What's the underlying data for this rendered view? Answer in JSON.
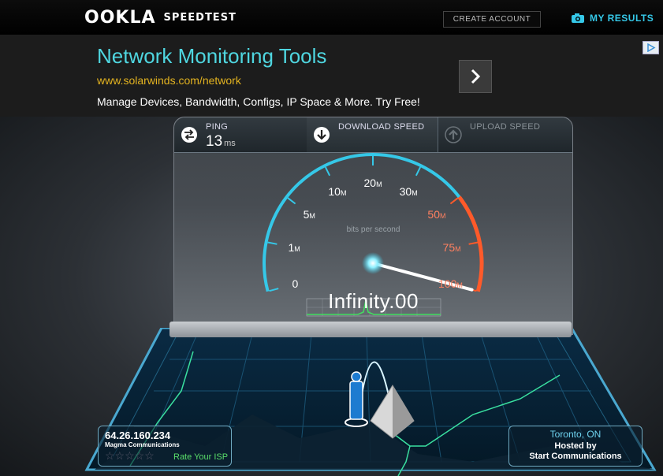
{
  "header": {
    "logo_brand": "OOKLA",
    "logo_product": "SPEEDTEST",
    "create_account": "CREATE ACCOUNT",
    "my_results": "MY RESULTS"
  },
  "ad": {
    "title": "Network Monitoring Tools",
    "url": "www.solarwinds.com/network",
    "description": "Manage Devices, Bandwidth, Configs, IP Space & More. Try Free!",
    "arrow_icon": "chevron-right-icon",
    "choices_icon": "adchoices-icon"
  },
  "stats": {
    "ping": {
      "label": "PING",
      "value": "13",
      "unit": "ms"
    },
    "download": {
      "label": "DOWNLOAD SPEED"
    },
    "upload": {
      "label": "UPLOAD SPEED"
    }
  },
  "gauge": {
    "subtitle": "bits per second",
    "readout": "Infinity.00",
    "ticks": [
      {
        "num": "0",
        "unit": ""
      },
      {
        "num": "1",
        "unit": "M"
      },
      {
        "num": "5",
        "unit": "M"
      },
      {
        "num": "10",
        "unit": "M"
      },
      {
        "num": "20",
        "unit": "M"
      },
      {
        "num": "30",
        "unit": "M"
      },
      {
        "num": "50",
        "unit": "M"
      },
      {
        "num": "75",
        "unit": "M"
      },
      {
        "num": "100",
        "unit": "M"
      }
    ],
    "colors": {
      "arc": "#35c8e8",
      "hot": "#ff5a2a"
    }
  },
  "client": {
    "ip": "64.26.160.234",
    "isp": "Magma Communications",
    "stars": "☆☆☆☆☆",
    "rate_label": "Rate Your ISP"
  },
  "server": {
    "city": "Toronto, ON",
    "hosted_label": "Hosted by",
    "host": "Start Communications"
  }
}
